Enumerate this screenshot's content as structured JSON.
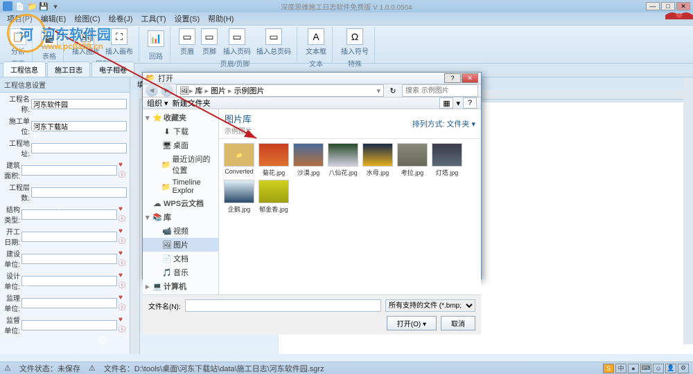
{
  "titlebar": {
    "title": "深度思维施工日志软件免费版 V 1.0.0.0504"
  },
  "menubar": {
    "items": [
      "项目(P)",
      "编辑(E)",
      "绘图(C)",
      "绘卷(J)",
      "工具(T)",
      "设置(S)",
      "帮助(H)"
    ]
  },
  "ribbon": {
    "groups": [
      {
        "label": "页面",
        "buttons": [
          {
            "icon": "📋",
            "label": "分析"
          }
        ]
      },
      {
        "label": "表格",
        "buttons": [
          {
            "icon": "▦",
            "label": ""
          }
        ]
      },
      {
        "label": "图形",
        "buttons": [
          {
            "icon": "🖼",
            "label": "插入图片"
          },
          {
            "icon": "⛶",
            "label": "插入画布"
          }
        ]
      },
      {
        "label": "回路",
        "buttons": [
          {
            "icon": "📊",
            "label": ""
          }
        ]
      },
      {
        "label": "页眉/页脚",
        "buttons": [
          {
            "icon": "▭",
            "label": "页眉"
          },
          {
            "icon": "▭",
            "label": "页脚"
          },
          {
            "icon": "▭",
            "label": "插入页码"
          },
          {
            "icon": "▭",
            "label": "插入总页码"
          }
        ]
      },
      {
        "label": "文本",
        "buttons": [
          {
            "icon": "A",
            "label": "文本框"
          }
        ]
      },
      {
        "label": "特殊",
        "buttons": [
          {
            "icon": "Ω",
            "label": "插入符号"
          }
        ]
      }
    ]
  },
  "sec_tabs": [
    "工程信息",
    "施工日志",
    "电子相卷"
  ],
  "form_panel": {
    "header": "工程信息设置",
    "fields": [
      {
        "label": "工程名称:",
        "value": "河东软件园",
        "heart": false
      },
      {
        "label": "施工单位:",
        "value": "河东下载站",
        "heart": false
      },
      {
        "label": "工程地址:",
        "value": "",
        "heart": false
      },
      {
        "label": "建筑面积:",
        "value": "",
        "heart": true
      },
      {
        "label": "工程层数:",
        "value": "",
        "heart": false
      },
      {
        "label": "结构类型:",
        "value": "",
        "heart": true
      },
      {
        "label": "开工日期:",
        "value": "",
        "heart": true
      },
      {
        "label": "建设单位:",
        "value": "",
        "heart": true
      },
      {
        "label": "设计单位:",
        "value": "",
        "heart": true
      },
      {
        "label": "监理单位:",
        "value": "",
        "heart": true
      },
      {
        "label": "监督单位:",
        "value": "",
        "heart": true
      }
    ]
  },
  "editor_tab": "填制说明",
  "dialog": {
    "title": "打开",
    "path_crumbs": [
      "库",
      "图片",
      "示例图片"
    ],
    "search_placeholder": "搜索 示例图片",
    "toolbar": {
      "organize": "组织 ▾",
      "newfolder": "新建文件夹"
    },
    "view": {
      "sort_label": "排列方式:",
      "sort_value": "文件夹 ▾"
    },
    "sidebar": [
      {
        "level": 1,
        "icon": "⭐",
        "label": "收藏夹",
        "expander": "▾"
      },
      {
        "level": 2,
        "icon": "⬇",
        "label": "下载"
      },
      {
        "level": 2,
        "icon": "🖥",
        "label": "桌面"
      },
      {
        "level": 2,
        "icon": "📁",
        "label": "最近访问的位置"
      },
      {
        "level": 2,
        "icon": "📁",
        "label": "Timeline Explor"
      },
      {
        "level": 1,
        "icon": "☁",
        "label": "WPS云文档",
        "expander": ""
      },
      {
        "level": 1,
        "icon": "📚",
        "label": "库",
        "expander": "▾"
      },
      {
        "level": 2,
        "icon": "📹",
        "label": "视频"
      },
      {
        "level": 2,
        "icon": "🖼",
        "label": "图片",
        "selected": true
      },
      {
        "level": 2,
        "icon": "📄",
        "label": "文档"
      },
      {
        "level": 2,
        "icon": "🎵",
        "label": "音乐"
      },
      {
        "level": 1,
        "icon": "💻",
        "label": "计算机",
        "expander": "▸"
      }
    ],
    "library": {
      "title": "图片库",
      "subtitle": "示例图片"
    },
    "thumbs": [
      {
        "bg": "#d9b96a",
        "label": "Converted",
        "folder": true
      },
      {
        "bg": "linear-gradient(#c84020, #e07030)",
        "label": "菊花.jpg"
      },
      {
        "bg": "linear-gradient(#4a6a9a, #b07040)",
        "label": "沙漠.jpg"
      },
      {
        "bg": "linear-gradient(#2a4a2a, #d0d0e0)",
        "label": "八仙花.jpg"
      },
      {
        "bg": "linear-gradient(#1a2a4a, #e5b020)",
        "label": "水母.jpg"
      },
      {
        "bg": "linear-gradient(#8a8a7a, #6a6a5a)",
        "label": "考拉.jpg"
      },
      {
        "bg": "linear-gradient(#3a3a4a, #5a6a7a)",
        "label": "灯塔.jpg"
      },
      {
        "bg": "linear-gradient(#e0f0f8, #2a4a6a)",
        "label": "企鹅.jpg"
      },
      {
        "bg": "linear-gradient(#d0d020, #a0a010)",
        "label": "郁金香.jpg"
      }
    ],
    "filename_label": "文件名(N):",
    "filter": "所有支持的文件 (*.bmp; *.dib; ▾",
    "open_btn": "打开(O) ▾",
    "cancel_btn": "取消"
  },
  "statusbar": {
    "file_status_label": "文件状态：",
    "file_status": "未保存",
    "path_label": "文件名：",
    "path": "D:\\tools\\桌面\\河东下载站\\data\\施工日志\\河东软件园.sgrz"
  },
  "watermark": {
    "title": "河东软件园",
    "url": "www.pc0359.cn"
  }
}
